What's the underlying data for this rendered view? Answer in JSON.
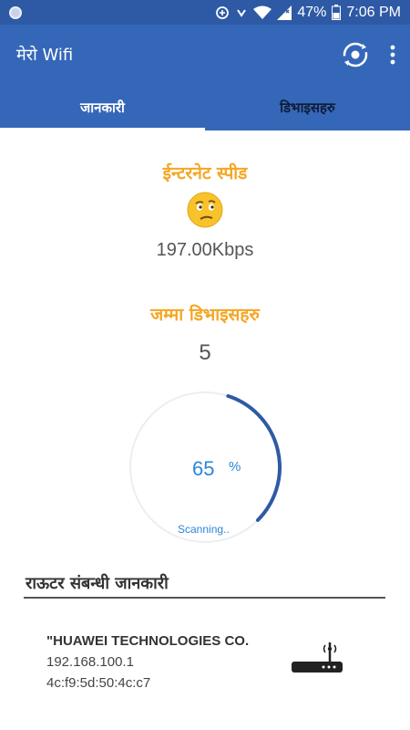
{
  "status_bar": {
    "battery": "47%",
    "time": "7:06 PM"
  },
  "app_bar": {
    "title": "मेरो Wifi"
  },
  "tabs": [
    {
      "label": "जानकारी",
      "active": true
    },
    {
      "label": "डिभाइसहरु",
      "active": false
    }
  ],
  "internet_speed": {
    "title": "ईन्टरनेट स्पीड",
    "value": "197.00Kbps"
  },
  "devices": {
    "title": "जम्मा डिभाइसहरु",
    "count": "5"
  },
  "scan": {
    "percent": "65",
    "percent_sign": "%",
    "progress": 0.65,
    "status": "Scanning.."
  },
  "router": {
    "heading": "राऊटर संबन्धी जानकारी",
    "vendor": "\"HUAWEI TECHNOLOGIES CO.",
    "ip": "192.168.100.1",
    "mac": "4c:f9:5d:50:4c:c7"
  },
  "colors": {
    "app_bar": "#3567b9",
    "status_bar": "#2e5aa5",
    "accent_orange": "#f5a623",
    "gauge_arc": "#2e5aa5",
    "gauge_text": "#2b86d8"
  },
  "icons": {
    "status_left": "notification-dot-icon",
    "sync": "sync-icon",
    "wifi": "wifi-icon",
    "signal": "signal-icon",
    "battery": "battery-icon",
    "refresh": "refresh-icon",
    "menu": "more-vert-icon",
    "emoji": "thinking-face-icon",
    "router": "router-icon"
  }
}
